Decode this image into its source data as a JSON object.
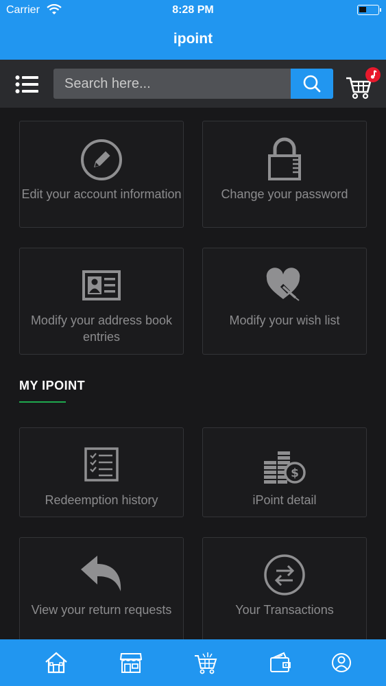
{
  "status_bar": {
    "carrier": "Carrier",
    "time": "8:28 PM"
  },
  "header": {
    "title": "ipoint"
  },
  "search": {
    "placeholder": "Search here..."
  },
  "account_tiles": [
    {
      "label": "Edit your account information",
      "icon": "pencil-circle-icon"
    },
    {
      "label": "Change your password",
      "icon": "lock-icon"
    },
    {
      "label": "Modify your address book entries",
      "icon": "address-card-icon"
    },
    {
      "label": "Modify your wish list",
      "icon": "heart-edit-icon"
    }
  ],
  "section": {
    "title": "MY IPOINT",
    "accent_color": "#1faa4f"
  },
  "ipoint_tiles": [
    {
      "label": "Redeemption history",
      "icon": "checklist-icon"
    },
    {
      "label": "iPoint detail",
      "icon": "coins-dollar-icon"
    },
    {
      "label": "View your return requests",
      "icon": "reply-arrow-icon"
    },
    {
      "label": "Your Transactions",
      "icon": "exchange-circle-icon"
    }
  ],
  "bottom_nav": [
    {
      "name": "home",
      "icon": "home-icon"
    },
    {
      "name": "store",
      "icon": "store-icon"
    },
    {
      "name": "cart",
      "icon": "cart-icon"
    },
    {
      "name": "wallet",
      "icon": "wallet-icon"
    },
    {
      "name": "profile",
      "icon": "user-icon"
    }
  ],
  "colors": {
    "primary": "#2196f0",
    "background": "#18181a",
    "badge": "#e8192c"
  }
}
